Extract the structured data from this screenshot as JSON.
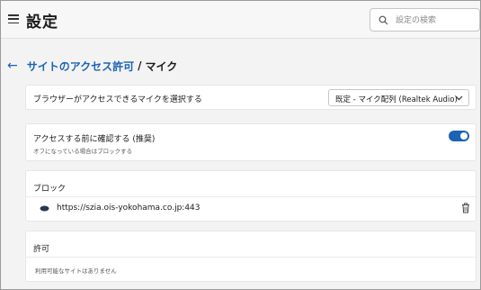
{
  "header": {
    "title": "設定",
    "search_placeholder": "設定の検索"
  },
  "breadcrumb": {
    "parent": "サイトのアクセス許可",
    "separator": "/",
    "current": "マイク"
  },
  "device": {
    "label": "ブラウザーがアクセスできるマイクを選択する",
    "selected": "既定 - マイク配列 (Realtek Audio)"
  },
  "ask_before_access": {
    "label": "アクセスする前に確認する (推奨)",
    "description": "オフになっている場合はブロックする",
    "enabled": true
  },
  "block": {
    "heading": "ブロック",
    "sites": [
      {
        "url": "https://szia.ois-yokohama.co.jp:443"
      }
    ]
  },
  "allow": {
    "heading": "許可",
    "empty_text": "利用可能なサイトはありません"
  },
  "colors": {
    "accent": "#1a63b5",
    "background": "#f3f3f3",
    "card": "#ffffff"
  },
  "icons": {
    "menu": "hamburger-icon",
    "search": "search-icon",
    "back": "back-arrow-icon",
    "dropdown": "chevron-down-icon",
    "site": "site-favicon-icon",
    "delete": "trash-icon"
  }
}
